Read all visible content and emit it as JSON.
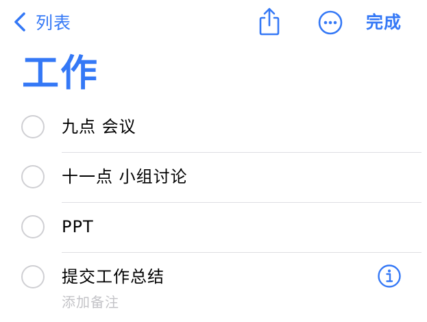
{
  "nav": {
    "back_label": "列表",
    "done_label": "完成",
    "icons": {
      "back": "chevron-left-icon",
      "share": "share-icon",
      "more": "ellipsis-circle-icon"
    }
  },
  "page": {
    "title": "工作"
  },
  "items": [
    {
      "text": "九点 会议",
      "completed": false
    },
    {
      "text": "十一点 小组讨论",
      "completed": false
    },
    {
      "text": "PPT",
      "completed": false
    },
    {
      "text": "提交工作总结",
      "completed": false,
      "note_placeholder": "添加备注",
      "info_icon": "info-circle-icon"
    }
  ],
  "colors": {
    "accent": "#3478F6",
    "circle_border": "#cfcfd3",
    "divider": "#dedee2",
    "placeholder": "#c3c3c7"
  }
}
